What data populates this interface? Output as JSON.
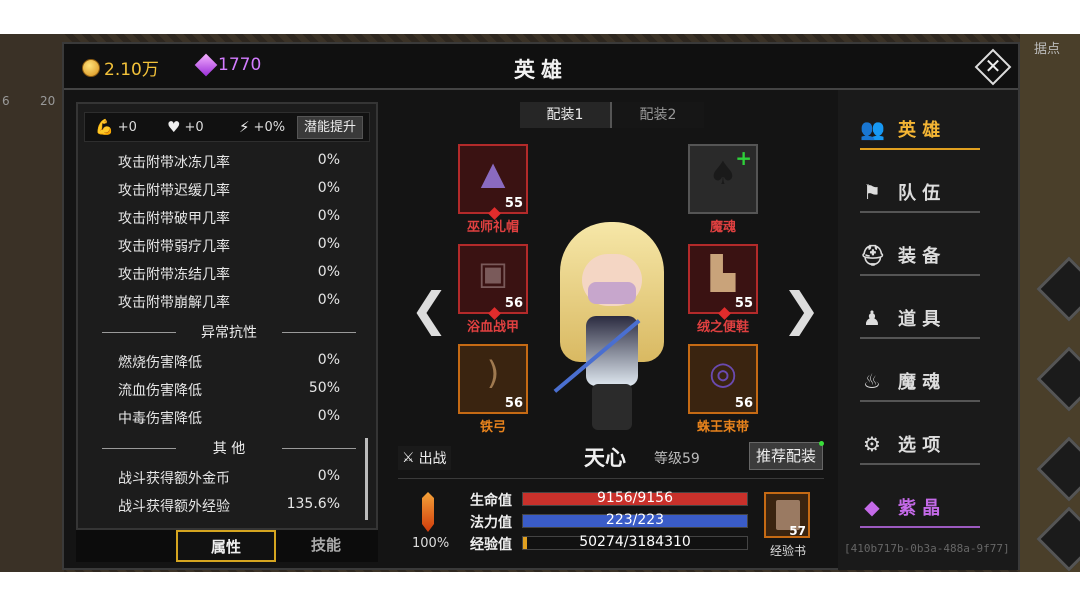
{
  "header": {
    "gold": "2.10万",
    "gems": "1770",
    "title": "英雄",
    "close_label": "✕"
  },
  "background": {
    "tag": "据点",
    "num_left": "6",
    "num_left2": "20"
  },
  "stat_bonus": {
    "strength": "+0",
    "health": "+0",
    "speed": "+0%",
    "potential_button": "潜能提升"
  },
  "attributes": [
    {
      "name": "攻击附带冰冻几率",
      "value": "0%"
    },
    {
      "name": "攻击附带迟缓几率",
      "value": "0%"
    },
    {
      "name": "攻击附带破甲几率",
      "value": "0%"
    },
    {
      "name": "攻击附带弱疗几率",
      "value": "0%"
    },
    {
      "name": "攻击附带冻结几率",
      "value": "0%"
    },
    {
      "name": "攻击附带崩解几率",
      "value": "0%"
    }
  ],
  "section_resist": "异常抗性",
  "resists": [
    {
      "name": "燃烧伤害降低",
      "value": "0%"
    },
    {
      "name": "流血伤害降低",
      "value": "50%"
    },
    {
      "name": "中毒伤害降低",
      "value": "0%"
    }
  ],
  "section_other": "其 他",
  "others": [
    {
      "name": "战斗获得额外金币",
      "value": "0%"
    },
    {
      "name": "战斗获得额外经验",
      "value": "135.6%"
    }
  ],
  "left_tabs": [
    "属性",
    "技能"
  ],
  "loadouts": [
    "配装1",
    "配装2"
  ],
  "equipment": {
    "hat": {
      "name": "巫师礼帽",
      "level": "55"
    },
    "soul": {
      "name": "魔魂"
    },
    "armor": {
      "name": "浴血战甲",
      "level": "56"
    },
    "boots": {
      "name": "绒之便鞋",
      "level": "55"
    },
    "bow": {
      "name": "铁弓",
      "level": "56"
    },
    "belt": {
      "name": "蛛王束带",
      "level": "56"
    }
  },
  "hero": {
    "battle_label": "出战",
    "name": "天心",
    "level": "等级59",
    "recommend_button": "推荐配装"
  },
  "bars": {
    "power_pct": "100%",
    "hp_label": "生命值",
    "hp_text": "9156/9156",
    "hp_fraction": 1.0,
    "mp_label": "法力值",
    "mp_text": "223/223",
    "mp_fraction": 1.0,
    "exp_label": "经验值",
    "exp_text": "50274/3184310",
    "exp_fraction": 0.0158,
    "book_count": "57",
    "book_label": "经验书"
  },
  "menu": [
    {
      "label": "英 雄",
      "icon": "hero-icon"
    },
    {
      "label": "队 伍",
      "icon": "flag-icon"
    },
    {
      "label": "装 备",
      "icon": "helmet-icon"
    },
    {
      "label": "道 具",
      "icon": "bag-icon"
    },
    {
      "label": "魔 魂",
      "icon": "flame-icon"
    },
    {
      "label": "选 项",
      "icon": "gear-icon"
    },
    {
      "label": "紫 晶",
      "icon": "crystal-icon"
    }
  ],
  "session_id": "[410b717b-0b3a-488a-9f77]",
  "colors": {
    "gold": "#f3c23a",
    "gem": "#d37cff",
    "hp": "#c9312b",
    "mp": "#3a5cc8",
    "exp": "#e0a020",
    "active_menu": "#f4b534"
  }
}
